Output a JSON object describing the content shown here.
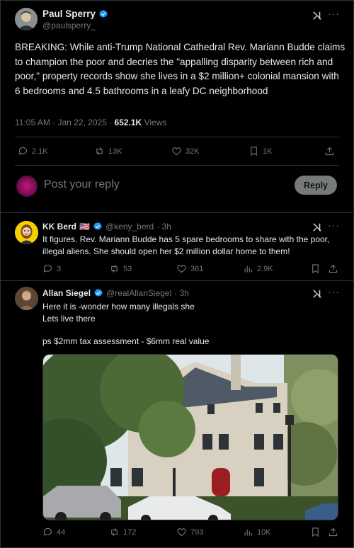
{
  "main_tweet": {
    "author_name": "Paul Sperry",
    "author_handle": "@paulsperry_",
    "text": "BREAKING: While anti-Trump National Cathedral Rev. Mariann Budde claims to champion the poor and decries the \"appalling disparity between rich and poor,\" property records show she lives in a $2 million+ colonial mansion with 6 bedrooms and 4.5 bathrooms in a leafy DC neighborhood",
    "time": "11:05 AM · Jan 22, 2025 · ",
    "views_count": "652.1K",
    "views_label": " Views",
    "replies": "2.1K",
    "reposts": "13K",
    "likes": "32K",
    "bookmarks": "1K"
  },
  "reply_box": {
    "placeholder": "Post your reply",
    "button_label": "Reply"
  },
  "replies": [
    {
      "author_name": "KK Berd",
      "flag": "🇺🇸",
      "author_handle": "@keny_berd",
      "time": "· 3h",
      "text": "It figures. Rev. Mariann Budde has 5 spare bedrooms to share with the poor, illegal aliens. She should open her $2 million dollar home to them!",
      "replies": "3",
      "reposts": "53",
      "likes": "361",
      "views": "2.9K"
    },
    {
      "author_name": "Allan Siegel",
      "author_handle": "@realAllanSiegel",
      "time": "· 3h",
      "text_line1": "Here it is -wonder how many illegals she",
      "text_line2": "Lets live there",
      "text_line3": "ps $2mm tax assessment - $6mm real value",
      "replies": "44",
      "reposts": "172",
      "likes": "793",
      "views": "10K"
    }
  ],
  "colors": {
    "background": "#000000",
    "text": "#e7e9ea",
    "secondary": "#71767b",
    "verified": "#1d9bf0",
    "divider": "#2f3336"
  }
}
